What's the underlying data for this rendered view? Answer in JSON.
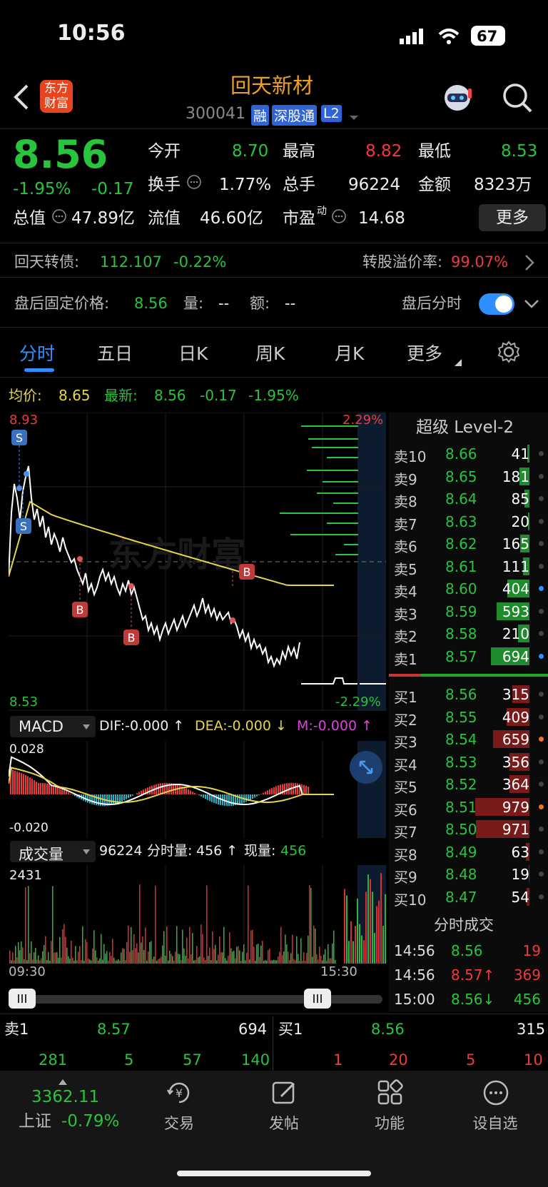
{
  "status_bar": {
    "time": "10:56",
    "battery": "67"
  },
  "header": {
    "title": "回天新材",
    "code": "300041",
    "badges": [
      "融",
      "深股通",
      "L2"
    ],
    "logo_text": "东方财富"
  },
  "quote": {
    "price": "8.56",
    "change_pct": "-1.95%",
    "change": "-0.17",
    "open_label": "今开",
    "open": "8.70",
    "high_label": "最高",
    "high": "8.82",
    "low_label": "最低",
    "low": "8.53",
    "turnover_label": "换手",
    "turnover": "1.77%",
    "volume_label": "总手",
    "volume": "96224",
    "amount_label": "金额",
    "amount": "8323万",
    "total_cap_label": "总值",
    "total_cap": "47.89亿",
    "float_cap_label": "流值",
    "float_cap": "46.60亿",
    "pe_label": "市盈",
    "pe_sup": "动",
    "pe": "14.68",
    "more_label": "更多"
  },
  "convertible": {
    "name": "回天转债:",
    "price": "112.107",
    "change": "-0.22%",
    "premium_label": "转股溢价率:",
    "premium": "99.07%"
  },
  "after_hours": {
    "label": "盘后固定价格:",
    "price": "8.56",
    "vol_label": "量:",
    "vol": "--",
    "amt_label": "额:",
    "amt": "--",
    "toggle_label": "盘后分时"
  },
  "tabs": [
    "分时",
    "五日",
    "日K",
    "周K",
    "月K",
    "更多"
  ],
  "chart_header": {
    "avg_label": "均价:",
    "avg": "8.65",
    "latest_label": "最新:",
    "latest": "8.56",
    "chg": "-0.17",
    "pct": "-1.95%"
  },
  "chart_labels": {
    "top_price": "8.93",
    "bottom_price": "8.53",
    "top_pct": "2.29%",
    "bottom_pct": "-2.29%",
    "time_start": "09:30",
    "time_end": "15:30",
    "watermark": "东方财富"
  },
  "markers": {
    "sell": "S",
    "buy": "B"
  },
  "macd": {
    "label": "MACD",
    "dif": "DIF:-0.000 ↑",
    "dea": "DEA:-0.000 ↓",
    "m": "M:-0.000 ↑",
    "top": "0.028",
    "bottom": "-0.020"
  },
  "volume_panel": {
    "label": "成交量",
    "total": "96224",
    "min_label": "分时量:",
    "min_vol": "456 ↑",
    "now_label": "现量:",
    "now": "456",
    "max": "2431"
  },
  "level2": {
    "title": "超级 Level-2",
    "asks": [
      {
        "label": "卖10",
        "price": "8.66",
        "vol": "41"
      },
      {
        "label": "卖9",
        "price": "8.65",
        "vol": "181"
      },
      {
        "label": "卖8",
        "price": "8.64",
        "vol": "85"
      },
      {
        "label": "卖7",
        "price": "8.63",
        "vol": "20"
      },
      {
        "label": "卖6",
        "price": "8.62",
        "vol": "165"
      },
      {
        "label": "卖5",
        "price": "8.61",
        "vol": "111"
      },
      {
        "label": "卖4",
        "price": "8.60",
        "vol": "404"
      },
      {
        "label": "卖3",
        "price": "8.59",
        "vol": "593"
      },
      {
        "label": "卖2",
        "price": "8.58",
        "vol": "210"
      },
      {
        "label": "卖1",
        "price": "8.57",
        "vol": "694"
      }
    ],
    "bids": [
      {
        "label": "买1",
        "price": "8.56",
        "vol": "315"
      },
      {
        "label": "买2",
        "price": "8.55",
        "vol": "409"
      },
      {
        "label": "买3",
        "price": "8.54",
        "vol": "659"
      },
      {
        "label": "买4",
        "price": "8.53",
        "vol": "356"
      },
      {
        "label": "买5",
        "price": "8.52",
        "vol": "364"
      },
      {
        "label": "买6",
        "price": "8.51",
        "vol": "979"
      },
      {
        "label": "买7",
        "price": "8.50",
        "vol": "971"
      },
      {
        "label": "买8",
        "price": "8.49",
        "vol": "63"
      },
      {
        "label": "买9",
        "price": "8.48",
        "vol": "19"
      },
      {
        "label": "买10",
        "price": "8.47",
        "vol": "54"
      }
    ],
    "ticks_title": "分时成交",
    "ticks": [
      {
        "time": "14:56",
        "price": "8.56",
        "vol": "19"
      },
      {
        "time": "14:56",
        "price": "8.57↑",
        "vol": "369"
      },
      {
        "time": "15:00",
        "price": "8.56↓",
        "vol": "456"
      }
    ]
  },
  "bottom_book": {
    "ask_label": "卖1",
    "ask_price": "8.57",
    "ask_vol": "694",
    "ask_queue": [
      "281",
      "5",
      "57",
      "140"
    ],
    "bid_label": "买1",
    "bid_price": "8.56",
    "bid_vol": "315",
    "bid_queue": [
      "1",
      "20",
      "5",
      "10"
    ]
  },
  "bottom_nav": {
    "index_value": "3362.11",
    "index_name": "上证",
    "index_pct": "-0.79%",
    "items": [
      "交易",
      "发帖",
      "功能",
      "设自选"
    ]
  },
  "colors": {
    "up": "#ef3a3a",
    "down": "#28c43c",
    "accent": "#2f8fff",
    "avg_line": "#e8d44a"
  }
}
